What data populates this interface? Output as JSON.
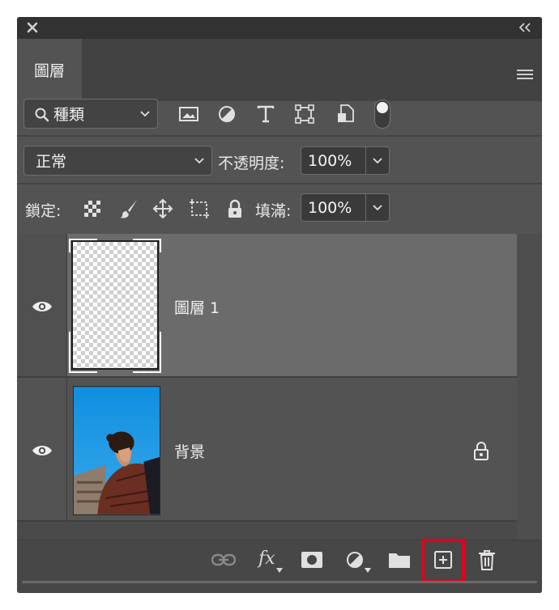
{
  "tab": {
    "label": "圖層"
  },
  "filter": {
    "selected": "種類"
  },
  "blend": {
    "selected": "正常",
    "opacity_label": "不透明度:",
    "opacity_value": "100%"
  },
  "lock": {
    "label": "鎖定:",
    "fill_label": "填滿:",
    "fill_value": "100%"
  },
  "layers": [
    {
      "name": "圖層 1",
      "selected": true,
      "locked": false
    },
    {
      "name": "背景",
      "selected": false,
      "locked": true
    }
  ],
  "colors": {
    "panel": "#535353",
    "selected_row": "#6b6b6b",
    "highlight_box": "#e4001a"
  }
}
